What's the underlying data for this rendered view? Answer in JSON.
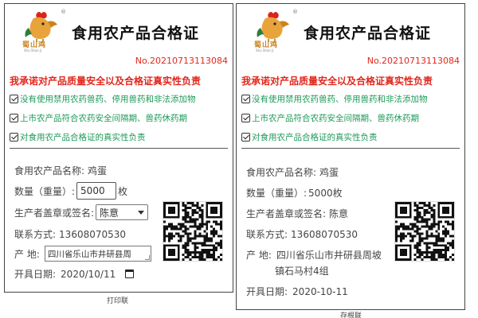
{
  "brand": {
    "logo_text": "蜀山鸡",
    "logo_sub": "Shu Shan Ji",
    "reg_mark": "®"
  },
  "certificate": {
    "title": "食用农产品合格证",
    "serial": "No.20210713113084",
    "promise": "我承诺对产品质量安全以及合格证真实性负责",
    "checks": [
      "没有使用禁用农药兽药、停用兽药和非法添加物",
      "上市农产品符合农药安全间隔期、兽药休药期",
      "对食用农产品合格证的真实性负责"
    ],
    "labels": {
      "product": "食用农产品名称:",
      "quantity": "数量（重量）:",
      "producer": "生产者盖章或签名:",
      "contact": "联系方式:",
      "origin": "产 地:",
      "date": "开具日期:"
    }
  },
  "print_copy": {
    "product": "鸡蛋",
    "quantity_value": "5000",
    "quantity_unit": "枚",
    "producer_selected": "陈意",
    "contact": "13608070530",
    "origin": "四川省乐山市井研县周",
    "date": "2020/10/11",
    "caption": "打印联"
  },
  "stub_copy": {
    "product": "鸡蛋",
    "quantity": "5000枚",
    "producer": "陈意",
    "contact": "13608070530",
    "origin_line1": "四川省乐山市井研县周坡",
    "origin_line2": "镇石马村4组",
    "date": "2020-10-11",
    "caption": "存根联"
  },
  "colors": {
    "red": "#e0281d",
    "green": "#1d9a58",
    "border": "#444444"
  }
}
